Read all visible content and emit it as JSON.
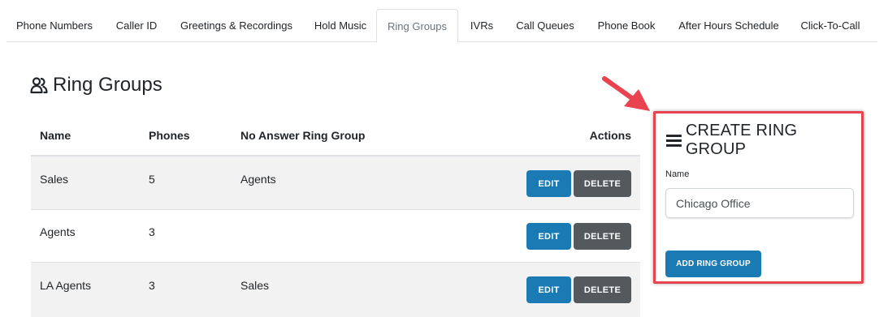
{
  "tabs": [
    {
      "label": "Phone Numbers"
    },
    {
      "label": "Caller ID"
    },
    {
      "label": "Greetings & Recordings"
    },
    {
      "label": "Hold Music"
    },
    {
      "label": "Ring Groups",
      "active": true
    },
    {
      "label": "IVRs"
    },
    {
      "label": "Call Queues"
    },
    {
      "label": "Phone Book"
    },
    {
      "label": "After Hours Schedule"
    },
    {
      "label": "Click-To-Call"
    }
  ],
  "page": {
    "title": "Ring Groups",
    "title_icon": "users-icon"
  },
  "table": {
    "headers": {
      "name": "Name",
      "phones": "Phones",
      "no_answer": "No Answer Ring Group",
      "actions": "Actions"
    },
    "rows": [
      {
        "name": "Sales",
        "phones": "5",
        "no_answer": "Agents",
        "edit": "EDIT",
        "delete": "DELETE"
      },
      {
        "name": "Agents",
        "phones": "3",
        "no_answer": "",
        "edit": "EDIT",
        "delete": "DELETE"
      },
      {
        "name": "LA Agents",
        "phones": "3",
        "no_answer": "Sales",
        "edit": "EDIT",
        "delete": "DELETE"
      }
    ]
  },
  "create_panel": {
    "title": "CREATE RING GROUP",
    "title_icon": "menu-icon",
    "name_label": "Name",
    "name_value": "Chicago Office",
    "submit_label": "ADD RING GROUP"
  },
  "colors": {
    "primary": "#1a7bb4",
    "secondary": "#54595e",
    "highlight": "#e8434f"
  }
}
